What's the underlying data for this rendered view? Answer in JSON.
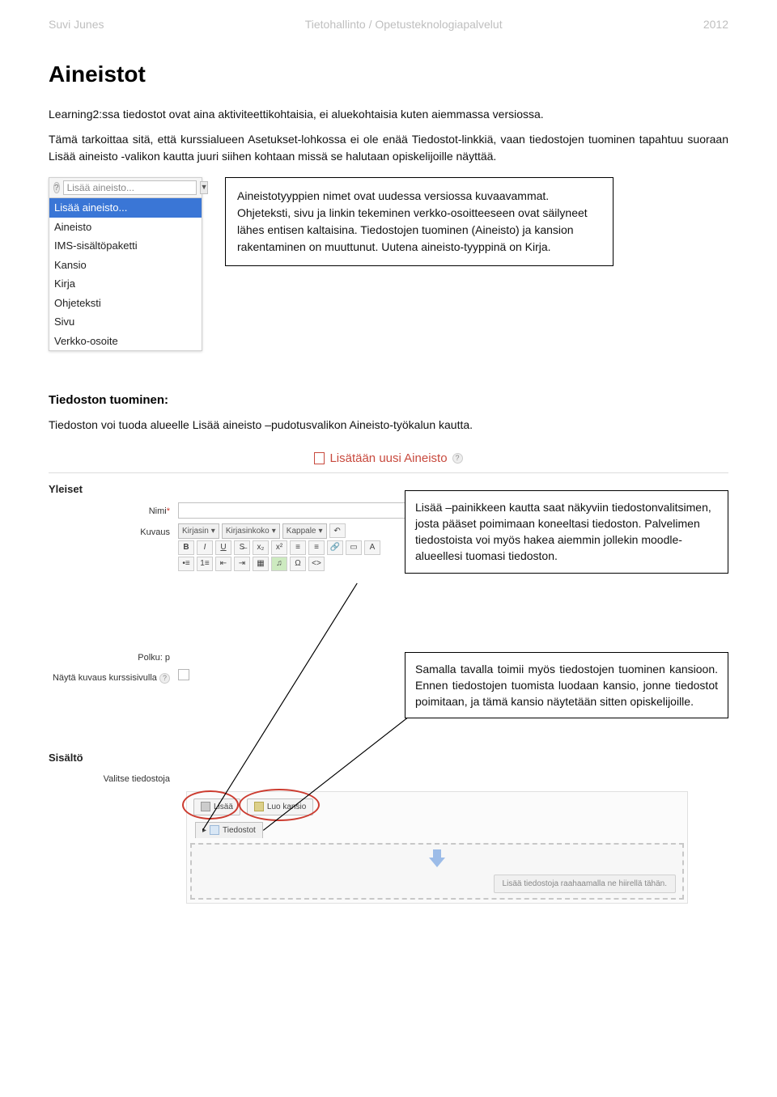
{
  "header": {
    "left": "Suvi Junes",
    "center": "Tietohallinto / Opetusteknologiapalvelut",
    "right": "2012"
  },
  "title": "Aineistot",
  "intro1": "Learning2:ssa tiedostot ovat aina aktiviteettikohtaisia, ei aluekohtaisia kuten aiemmassa versiossa.",
  "intro2": "Tämä tarkoittaa sitä, että kurssialueen Asetukset-lohkossa ei ole enää Tiedostot-linkkiä, vaan tiedostojen tuominen tapahtuu suoraan Lisää aineisto -valikon kautta juuri siihen kohtaan missä se halutaan opiskelijoille näyttää.",
  "dropdown": {
    "headerValue": "Lisää aineisto...",
    "items": [
      "Lisää aineisto...",
      "Aineisto",
      "IMS-sisältöpaketti",
      "Kansio",
      "Kirja",
      "Ohjeteksti",
      "Sivu",
      "Verkko-osoite"
    ],
    "selectedIndex": 0
  },
  "callout_types": "Aineistotyyppien nimet ovat uudessa versiossa kuvaavammat. Ohjeteksti, sivu ja linkin tekeminen verkko-osoitteeseen ovat säilyneet lähes entisen kaltaisina. Tiedostojen tuominen (Aineisto) ja kansion rakentaminen on muuttunut. Uutena aineisto-tyyppinä on Kirja.",
  "section_heading": "Tiedoston tuominen:",
  "section_text": "Tiedoston voi tuoda alueelle Lisää aineisto –pudotusvalikon Aineisto-työkalun kautta.",
  "form": {
    "title": "Lisätään uusi Aineisto",
    "group_yleiset": "Yleiset",
    "label_nimi": "Nimi",
    "label_kuvaus": "Kuvaus",
    "sel_kirjasin": "Kirjasin",
    "sel_koko": "Kirjasinkoko",
    "sel_kappale": "Kappale",
    "label_polku": "Polku: p",
    "label_nayta": "Näytä kuvaus kurssisivulla",
    "group_sisalto": "Sisältö",
    "label_valitse": "Valitse tiedostoja",
    "btn_lisaa": "Lisää",
    "btn_luokansio": "Luo kansio",
    "tab_tiedostot": "Tiedostot",
    "drop_hint": "Lisää tiedostoja raahaamalla ne hiirellä tähän."
  },
  "callout_lisaa": "Lisää –painikkeen kautta saat näkyviin tiedostonvalitsimen, josta pääset poimimaan koneeltasi tiedoston. Palvelimen tiedostoista voi myös hakea aiemmin jollekin moodle-alueellesi tuomasi tiedoston.",
  "callout_kansio": "Samalla tavalla toimii myös tiedostojen tuominen kansioon. Ennen tiedostojen tuomista luodaan kansio, jonne tiedostot poimitaan, ja tämä kansio näytetään sitten opiskelijoille."
}
